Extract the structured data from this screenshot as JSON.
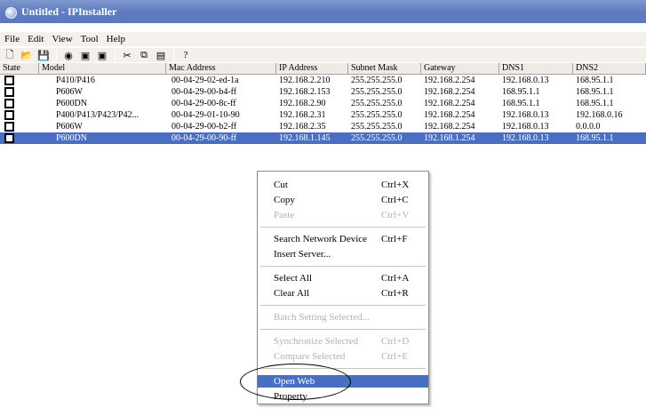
{
  "window": {
    "title": "Untitled - IPInstaller"
  },
  "menubar": {
    "items": [
      "File",
      "Edit",
      "View",
      "Tool",
      "Help"
    ]
  },
  "toolbar": {
    "buttons": [
      {
        "name": "new-icon",
        "glyph": "🗋"
      },
      {
        "name": "open-icon",
        "glyph": "📂"
      },
      {
        "name": "save-icon",
        "glyph": "💾"
      },
      {
        "name": "search-icon",
        "glyph": "◉"
      },
      {
        "name": "device-icon",
        "glyph": "▣"
      },
      {
        "name": "device2-icon",
        "glyph": "▣"
      },
      {
        "name": "cut-icon",
        "glyph": "✂"
      },
      {
        "name": "copy-icon",
        "glyph": "⧉"
      },
      {
        "name": "paste-icon",
        "glyph": "▤"
      },
      {
        "name": "help-icon",
        "glyph": "?"
      }
    ]
  },
  "table": {
    "columns": [
      "State",
      "Model",
      "Mac Address",
      "IP Address",
      "Subnet Mask",
      "Gateway",
      "DNS1",
      "DNS2"
    ],
    "rows": [
      [
        "P410/P416",
        "00-04-29-02-ed-1a",
        "192.168.2.210",
        "255.255.255.0",
        "192.168.2.254",
        "192.168.0.13",
        "168.95.1.1"
      ],
      [
        "P606W",
        "00-04-29-00-b4-ff",
        "192.168.2.153",
        "255.255.255.0",
        "192.168.2.254",
        "168.95.1.1",
        "168.95.1.1"
      ],
      [
        "P600DN",
        "00-04-29-00-8c-ff",
        "192.168.2.90",
        "255.255.255.0",
        "192.168.2.254",
        "168.95.1.1",
        "168.95.1.1"
      ],
      [
        "P400/P413/P423/P42...",
        "00-04-29-01-10-90",
        "192.168.2.31",
        "255.255.255.0",
        "192.168.2.254",
        "192.168.0.13",
        "192.168.0.16"
      ],
      [
        "P606W",
        "00-04-29-00-b2-ff",
        "192.168.2.35",
        "255.255.255.0",
        "192.168.2.254",
        "192.168.0.13",
        "0.0.0.0"
      ],
      [
        "P600DN",
        "00-04-29-00-90-ff",
        "192.168.1.145",
        "255.255.255.0",
        "192.168.1.254",
        "192.168.0.13",
        "168.95.1.1"
      ]
    ],
    "selected_row": 5
  },
  "context_menu": {
    "items": [
      {
        "label": "Cut",
        "shortcut": "Ctrl+X",
        "disabled": false
      },
      {
        "label": "Copy",
        "shortcut": "Ctrl+C",
        "disabled": false
      },
      {
        "label": "Paste",
        "shortcut": "Ctrl+V",
        "disabled": true
      },
      {
        "label": "Search Network Device",
        "shortcut": "Ctrl+F",
        "disabled": false
      },
      {
        "label": "Insert Server...",
        "shortcut": "",
        "disabled": false
      },
      {
        "label": "Select All",
        "shortcut": "Ctrl+A",
        "disabled": false
      },
      {
        "label": "Clear All",
        "shortcut": "Ctrl+R",
        "disabled": false
      },
      {
        "label": "Batch Setting Selected...",
        "shortcut": "",
        "disabled": true
      },
      {
        "label": "Synchronize Selected",
        "shortcut": "Ctrl+D",
        "disabled": true
      },
      {
        "label": "Compare Selected",
        "shortcut": "Ctrl+E",
        "disabled": true
      },
      {
        "label": "Open Web",
        "shortcut": "",
        "disabled": false,
        "highlighted": true
      },
      {
        "label": "Property",
        "shortcut": "",
        "disabled": false
      }
    ]
  },
  "colors": {
    "selection": "#4a6fc2",
    "titlebar": "#5f7dc0"
  }
}
